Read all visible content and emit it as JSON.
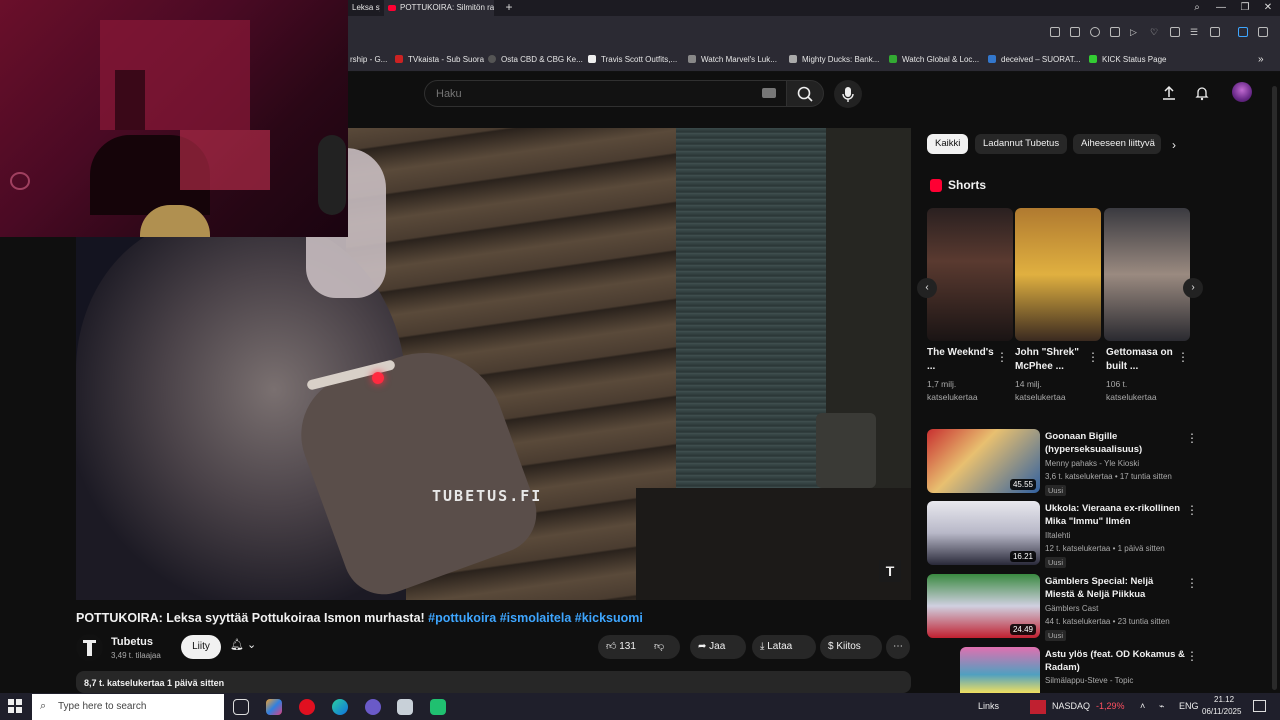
{
  "browser": {
    "tabs": [
      {
        "label": "Leksa sy"
      },
      {
        "label": "POTTUKOIRA: Silmitön ra"
      }
    ],
    "bookmarks": [
      {
        "label": "rship - G..."
      },
      {
        "label": "TVkaista - Sub Suora"
      },
      {
        "label": "Osta CBD & CBG Ke..."
      },
      {
        "label": "Travis Scott Outfits,..."
      },
      {
        "label": "Watch Marvel's Luk..."
      },
      {
        "label": "Mighty Ducks: Bank..."
      },
      {
        "label": "Watch Global & Loc..."
      },
      {
        "label": "deceived – SUORAT..."
      },
      {
        "label": "KICK Status Page"
      }
    ]
  },
  "header": {
    "search_placeholder": "Haku"
  },
  "video": {
    "watermark": "TUBETUS.FI",
    "title_main": "POTTUKOIRA: Leksa syyttää Pottukoiraa Ismon murhasta! ",
    "title_tags": "#pottukoira #ismolaitela #kicksuomi",
    "channel_name": "Tubetus",
    "subscribers": "3,49 t. tilaajaa",
    "join_label": "Liity",
    "like_count": "131",
    "share_label": "Jaa",
    "download_label": "Lataa",
    "thanks_label": "Kiitos",
    "description_stats": "8,7 t. katselukertaa  1 päivä sitten"
  },
  "sidebar": {
    "chips": [
      "Kaikki",
      "Ladannut Tubetus",
      "Aiheeseen liittyvä"
    ],
    "shorts_heading": "Shorts",
    "shorts": [
      {
        "title": "The Weeknd's ...",
        "views": "1,7 milj. katselukertaa"
      },
      {
        "title": "John \"Shrek\" McPhee ...",
        "views": "14 milj. katselukertaa"
      },
      {
        "title": "Gettomasa on built ...",
        "views": "106 t. katselukertaa"
      }
    ],
    "videos": [
      {
        "title": "Goonaan Bigille (hyperseksuaalisuus)",
        "channel": "Menny pahaks - Yle Kioski",
        "stats": "3,6 t. katselukertaa • 17 tuntia sitten",
        "badge": "Uusi",
        "duration": "45.55"
      },
      {
        "title": "Ukkola: Vieraana ex-rikollinen Mika \"Immu\" Ilmén",
        "channel": "Iltalehti",
        "stats": "12 t. katselukertaa • 1 päivä sitten",
        "badge": "Uusi",
        "duration": "16.21"
      },
      {
        "title": "Gämblers Special: Neljä Miestä & Neljä Piikkua",
        "channel": "Gämblers Cast",
        "stats": "44 t. katselukertaa • 23 tuntia sitten",
        "badge": "Uusi",
        "duration": "24.49"
      },
      {
        "title": "Astu ylös (feat. OD Kokamus & Radam)",
        "channel": "Silmälappu-Steve - Topic",
        "stats": "",
        "badge": "",
        "duration": ""
      }
    ]
  },
  "taskbar": {
    "search_placeholder": "Type here to search",
    "links_label": "Links",
    "ticker_name": "NASDAQ",
    "ticker_change": "-1,29%",
    "language": "ENG",
    "time": "21.12",
    "date": "06/11/2025"
  },
  "colors": {
    "background": "#0f0f0f",
    "accent_red": "#ff0033",
    "link_blue": "#3ea6ff"
  }
}
